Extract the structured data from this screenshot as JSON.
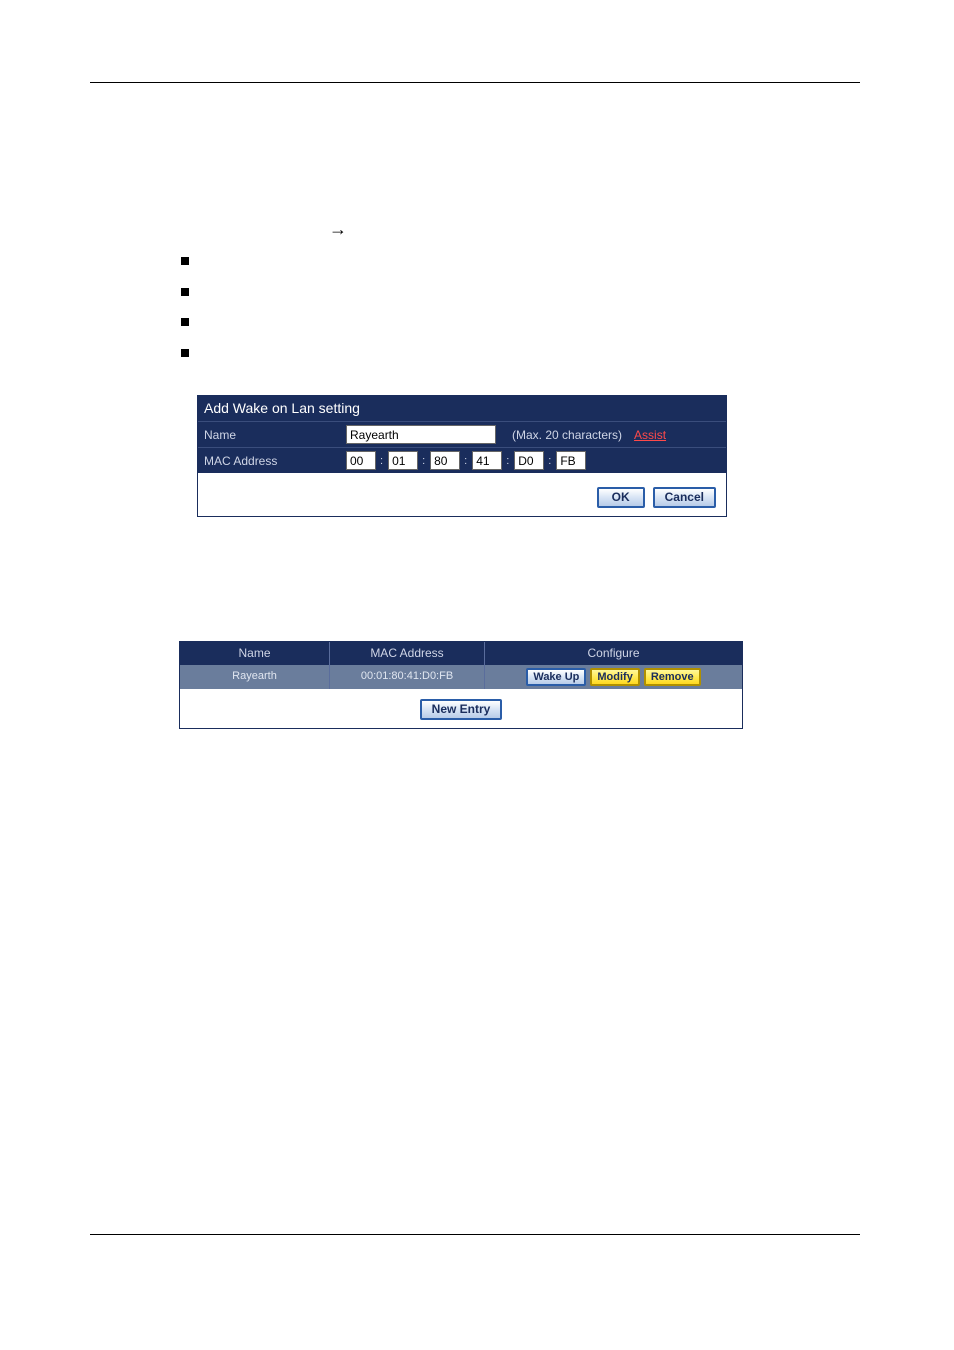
{
  "rules": {
    "top_hr": true,
    "bottom_hr": true
  },
  "arrow_glyph": "→",
  "form": {
    "title": "Add Wake on Lan setting",
    "name_label": "Name",
    "name_value": "Rayearth",
    "name_hint": "(Max. 20 characters)",
    "assist_label": "Assist",
    "mac_label": "MAC Address",
    "mac": [
      "00",
      "01",
      "80",
      "41",
      "D0",
      "FB"
    ],
    "ok_label": "OK",
    "cancel_label": "Cancel"
  },
  "table": {
    "headers": {
      "name": "Name",
      "mac": "MAC Address",
      "configure": "Configure"
    },
    "row": {
      "name": "Rayearth",
      "mac": "00:01:80:41:D0:FB"
    },
    "buttons": {
      "wake": "Wake Up",
      "modify": "Modify",
      "remove": "Remove",
      "new_entry": "New Entry"
    }
  }
}
